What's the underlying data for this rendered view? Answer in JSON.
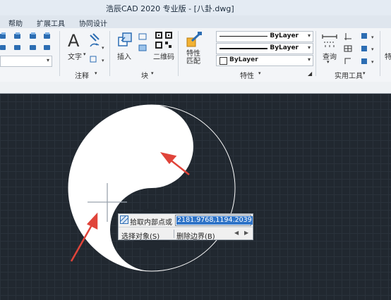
{
  "app": {
    "title": "浩辰CAD 2020 专业版 - [八卦.dwg]"
  },
  "menu": {
    "items": [
      "帮助",
      "扩展工具",
      "协同设计"
    ]
  },
  "ribbon": {
    "groups": {
      "annotation": "注释",
      "block": "块",
      "properties": "特性",
      "utilities": "实用工具"
    },
    "buttons": {
      "text": "文字",
      "insert": "插入",
      "qrcode": "二维码",
      "match_line1": "特性",
      "match_line2": "匹配",
      "query": "查询",
      "truncated": "特"
    },
    "combos": {
      "linetype": "ByLayer",
      "lineweight": "ByLayer",
      "color": "ByLayer"
    }
  },
  "command_popup": {
    "prompt": "拾取内部点或",
    "value": "2181.9768,1194.2039",
    "options": [
      "选择对象(S)",
      "删除边界(B)"
    ]
  },
  "colors": {
    "canvas_bg": "#212830",
    "accent_blue": "#2f6fb6",
    "arrow_red": "#e0443a",
    "selection_blue": "#2f74c8"
  },
  "icons": [
    "text-A-icon",
    "insert-block-icon",
    "qrcode-icon",
    "match-properties-icon",
    "query-icon",
    "crosshair-cursor-icon",
    "hatch-icon"
  ]
}
